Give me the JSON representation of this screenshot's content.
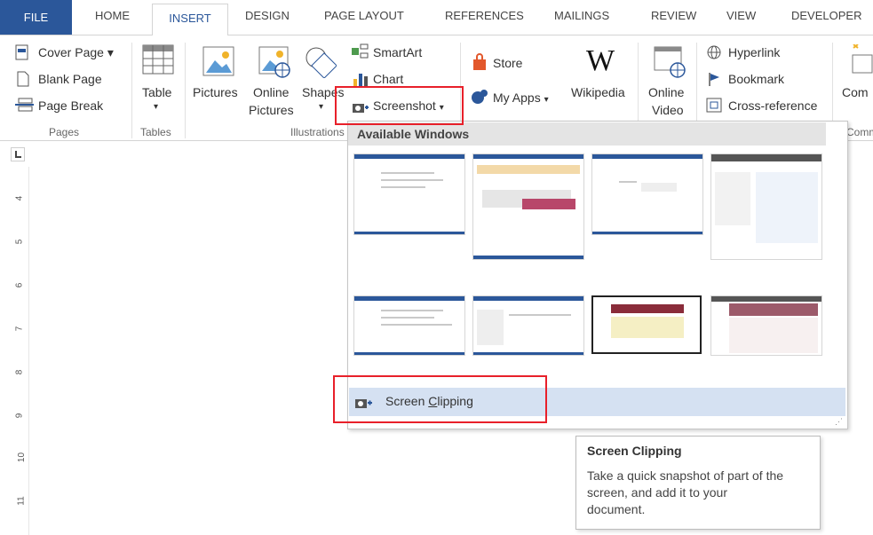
{
  "tabs": [
    "FILE",
    "HOME",
    "INSERT",
    "DESIGN",
    "PAGE LAYOUT",
    "REFERENCES",
    "MAILINGS",
    "REVIEW",
    "VIEW",
    "DEVELOPER"
  ],
  "pages_group": {
    "cover_page": "Cover Page",
    "blank_page": "Blank Page",
    "page_break": "Page Break",
    "label": "Pages"
  },
  "tables_group": {
    "table": "Table",
    "label": "Tables"
  },
  "illustrations_group": {
    "pictures": "Pictures",
    "online": "Online",
    "online2": "Pictures",
    "shapes": "Shapes",
    "smartart": "SmartArt",
    "chart": "Chart",
    "screenshot": "Screenshot",
    "label": "Illustrations"
  },
  "apps_group": {
    "store": "Store",
    "my_apps": "My Apps",
    "wikipedia": "Wikipedia"
  },
  "media_group": {
    "online": "Online",
    "video": "Video"
  },
  "links_group": {
    "hyperlink": "Hyperlink",
    "bookmark": "Bookmark",
    "cross_reference": "Cross-reference"
  },
  "comments_group": {
    "comment": "Com",
    "label": "Comm"
  },
  "dropdown": {
    "header": "Available Windows",
    "screen_clipping_prefix": "Screen ",
    "screen_clipping_mnemonic": "C",
    "screen_clipping_rest": "lipping"
  },
  "tooltip": {
    "title": "Screen Clipping",
    "line1": "Take a quick snapshot of part of the",
    "line2": "screen, and add it to your",
    "line3": "document."
  },
  "ruler_numbers": [
    "4",
    "5",
    "6",
    "7",
    "8",
    "9",
    "10",
    "11"
  ],
  "colors": {
    "accent": "#2b579a",
    "highlight": "#d5e1f2",
    "annotation": "#e8202a"
  }
}
